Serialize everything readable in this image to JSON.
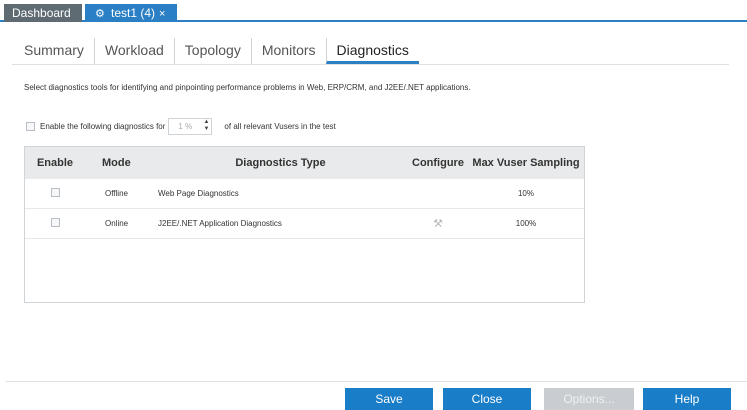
{
  "doc_tabs": {
    "dashboard": "Dashboard",
    "test": "test1 (4)",
    "test_icon": "test-icon",
    "close": "×"
  },
  "sub_tabs": [
    "Summary",
    "Workload",
    "Topology",
    "Monitors",
    "Diagnostics"
  ],
  "active_sub_tab": "Diagnostics",
  "description": "Select diagnostics tools for identifying and pinpointing performance problems in Web, ERP/CRM, and J2EE/.NET applications.",
  "enable_row": {
    "label_before": "Enable the following diagnostics for",
    "percent_value": "1 %",
    "label_after": "of all relevant Vusers in the test"
  },
  "table": {
    "headers": {
      "enable": "Enable",
      "mode": "Mode",
      "type": "Diagnostics Type",
      "configure": "Configure",
      "max": "Max Vuser Sampling"
    },
    "rows": [
      {
        "mode": "Offline",
        "type": "Web Page Diagnostics",
        "max": "10%"
      },
      {
        "mode": "Online",
        "type": "J2EE/.NET Application Diagnostics",
        "max": "100%"
      }
    ]
  },
  "buttons": {
    "save": "Save",
    "close": "Close",
    "options": "Options...",
    "help": "Help"
  },
  "colors": {
    "accent": "#2b7fc4",
    "button": "#1a7dc7",
    "disabled": "#c9cdd1"
  }
}
